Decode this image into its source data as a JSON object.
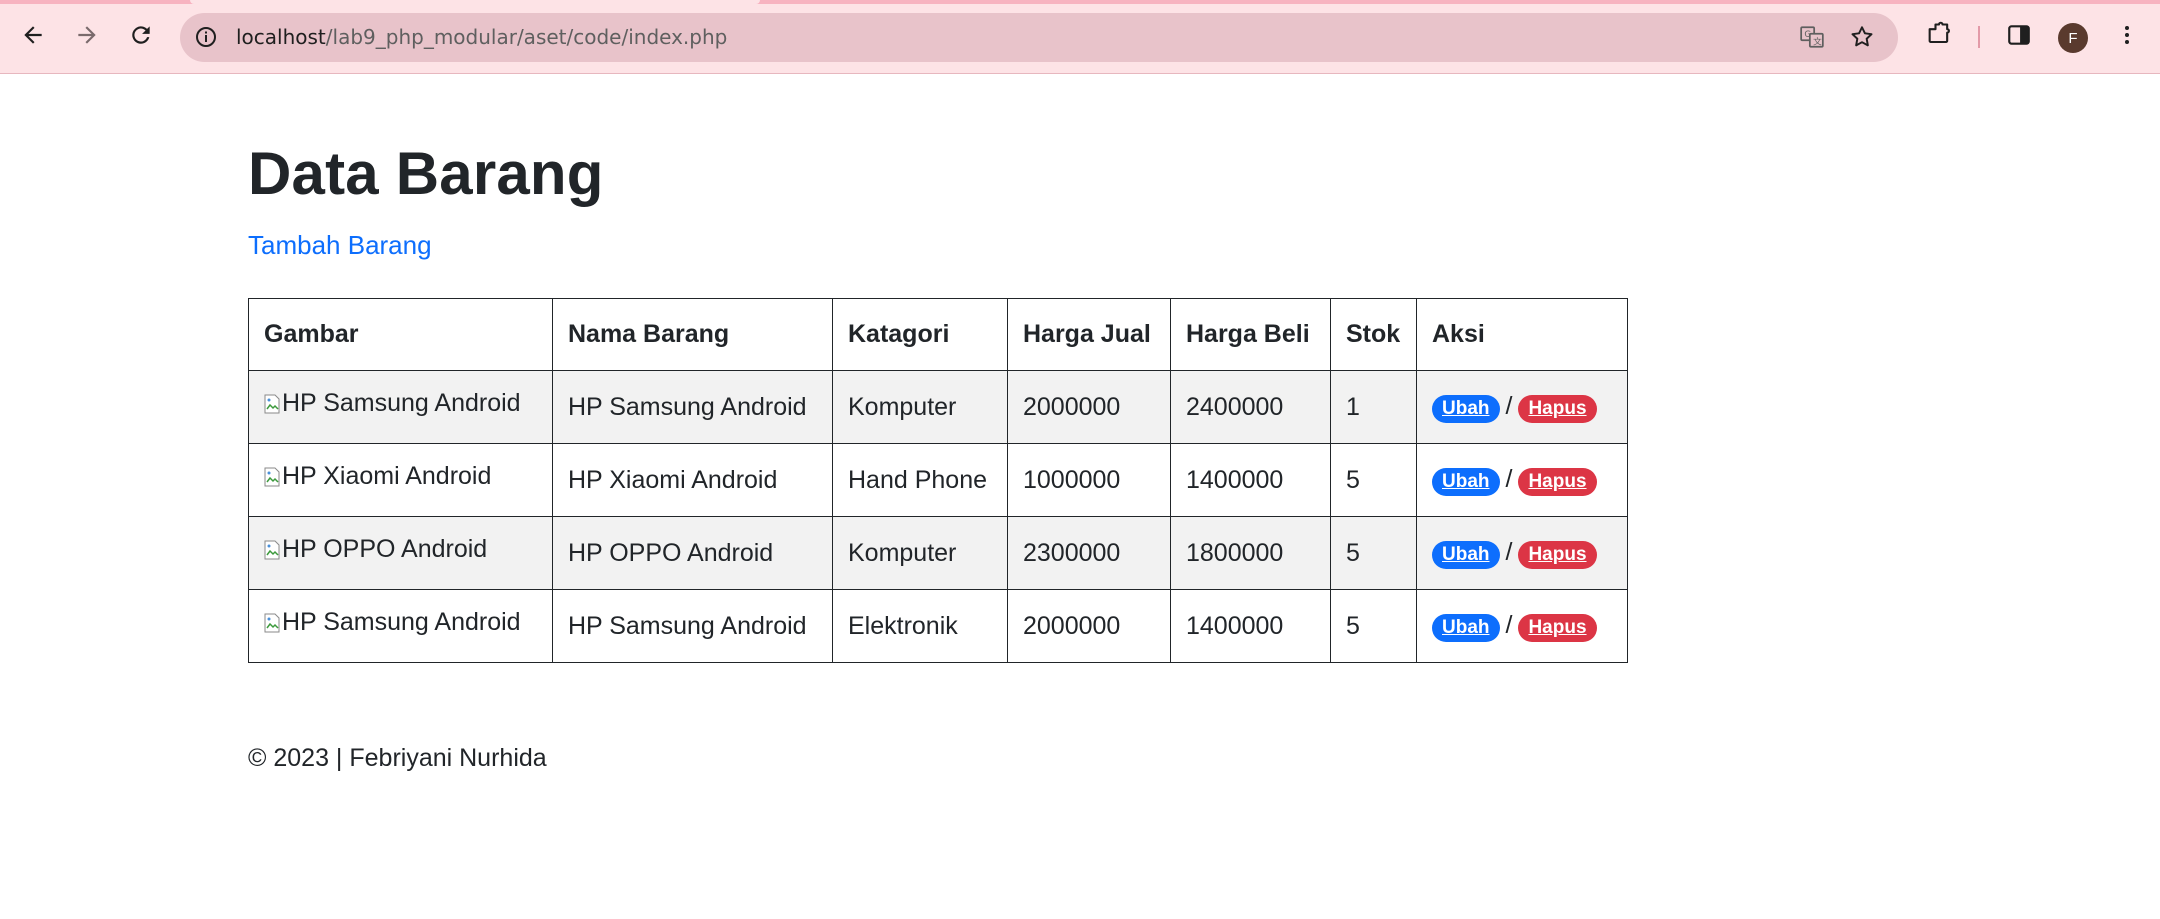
{
  "browser": {
    "url_host": "localhost",
    "url_path": "/lab9_php_modular/aset/code/index.php",
    "avatar_letter": "F",
    "accent_color": "#fde3e6"
  },
  "page": {
    "title": "Data Barang",
    "add_link": "Tambah Barang",
    "footer": "© 2023 | Febriyani Nurhida"
  },
  "table": {
    "headers": [
      "Gambar",
      "Nama Barang",
      "Katagori",
      "Harga Jual",
      "Harga Beli",
      "Stok",
      "Aksi"
    ],
    "rows": [
      {
        "gambar_alt": "HP Samsung Android",
        "nama": "HP Samsung Android",
        "kategori": "Komputer",
        "harga_jual": "2000000",
        "harga_beli": "2400000",
        "stok": "1"
      },
      {
        "gambar_alt": "HP Xiaomi Android",
        "nama": "HP Xiaomi Android",
        "kategori": "Hand Phone",
        "harga_jual": "1000000",
        "harga_beli": "1400000",
        "stok": "5"
      },
      {
        "gambar_alt": "HP OPPO Android",
        "nama": "HP OPPO Android",
        "kategori": "Komputer",
        "harga_jual": "2300000",
        "harga_beli": "1800000",
        "stok": "5"
      },
      {
        "gambar_alt": "HP Samsung Android",
        "nama": "HP Samsung Android",
        "kategori": "Elektronik",
        "harga_jual": "2000000",
        "harga_beli": "1400000",
        "stok": "5"
      }
    ],
    "edit_label": "Ubah",
    "separator": "/",
    "delete_label": "Hapus",
    "edit_color": "#0d6efd",
    "delete_color": "#dc3545"
  }
}
